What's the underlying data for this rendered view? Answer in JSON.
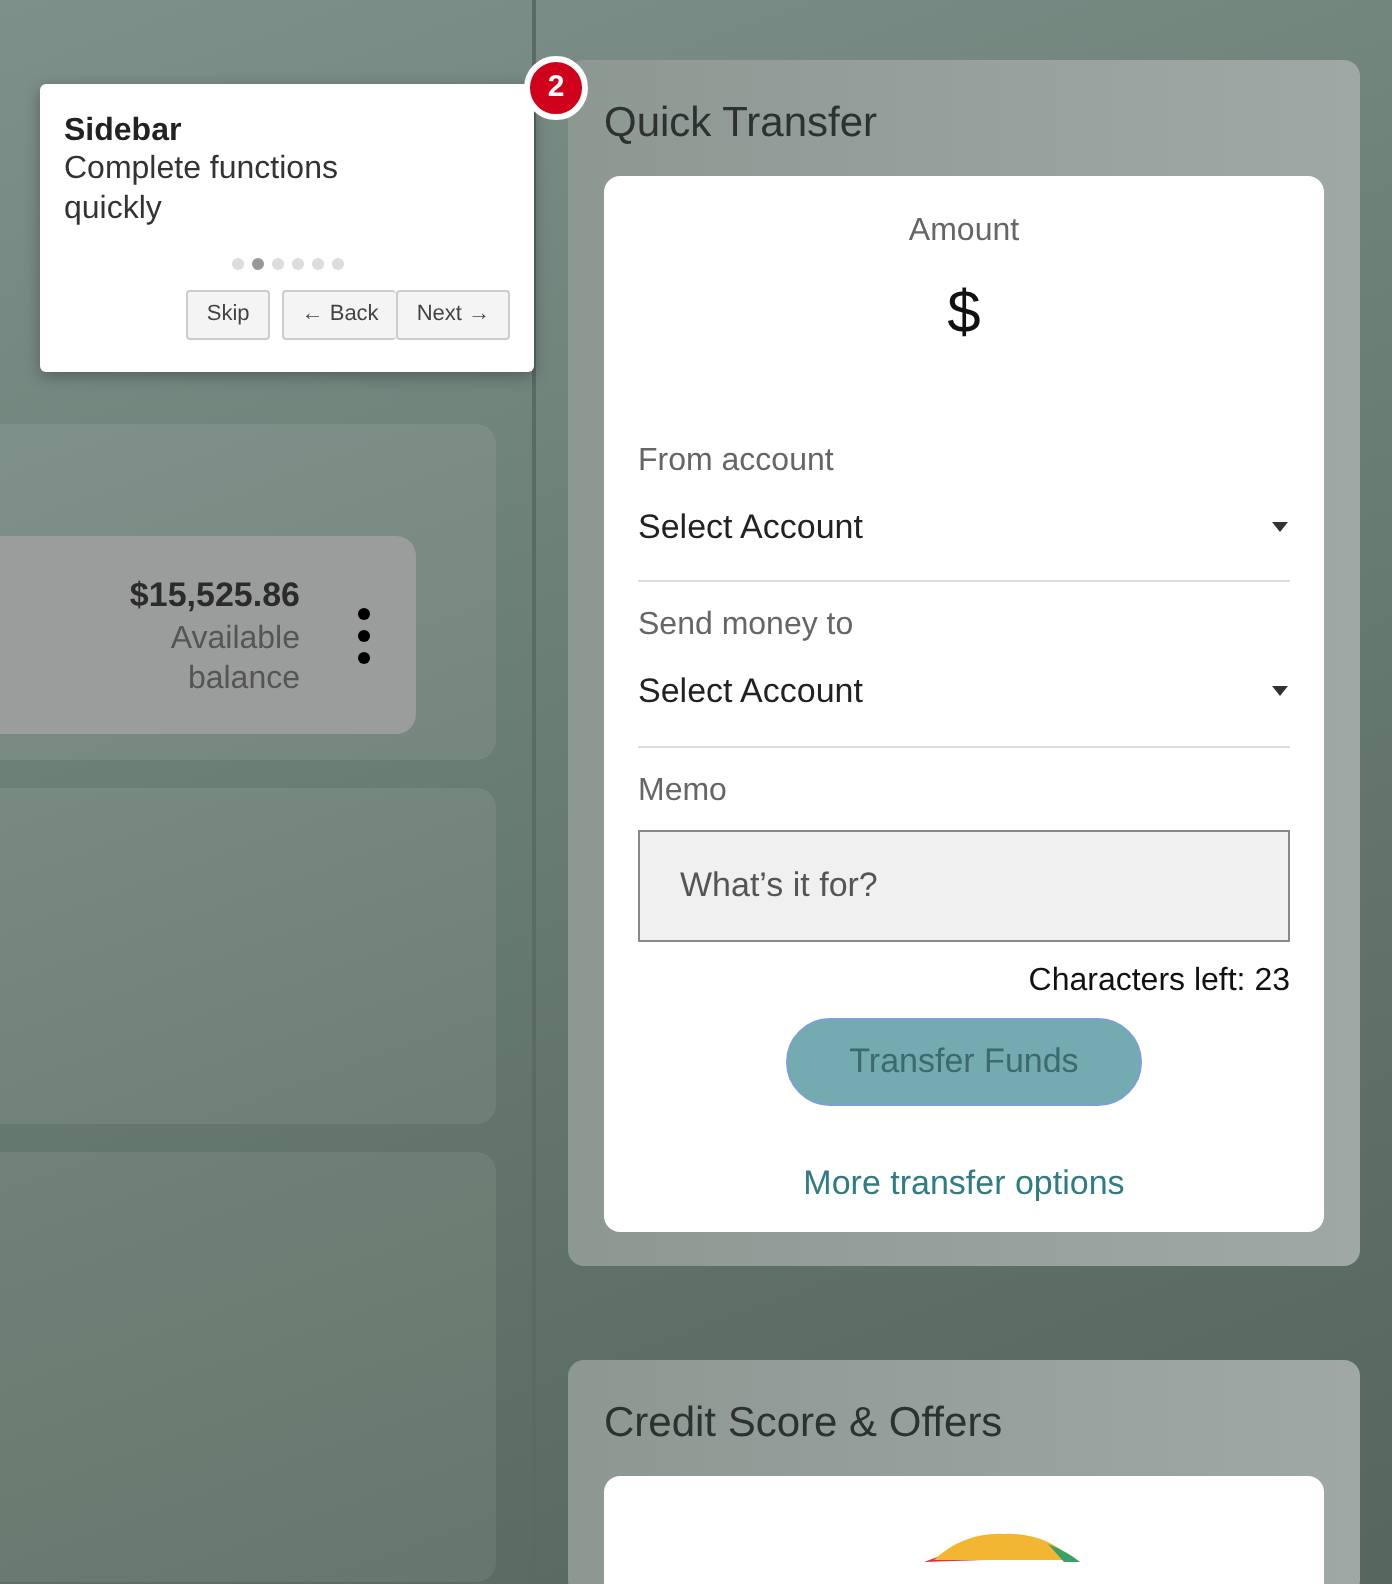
{
  "tour_popup": {
    "badge": "2",
    "title": "Sidebar",
    "text": "Complete functions quickly",
    "steps": [
      {
        "selected": false
      },
      {
        "selected": true
      },
      {
        "selected": false
      },
      {
        "selected": false
      },
      {
        "selected": false
      },
      {
        "selected": false
      }
    ],
    "skip": "Skip",
    "back": "← Back",
    "next": "Next →"
  },
  "balance_card": {
    "amount": "$15,525.86",
    "label": "Available balance"
  },
  "quick_transfer": {
    "title": "Quick Transfer",
    "amount_label": "Amount",
    "currency": "$",
    "from_label": "From account",
    "from_value": "Select Account",
    "to_label": "Send money to",
    "to_value": "Select Account",
    "memo_label": "Memo",
    "memo_placeholder": "What’s it for?",
    "chars_left": "Characters left: 23",
    "submit": {
      "label": "Transfer Funds",
      "disabled": true
    },
    "link": "More transfer options"
  },
  "credit_score": {
    "title": "Credit Score & Offers"
  }
}
